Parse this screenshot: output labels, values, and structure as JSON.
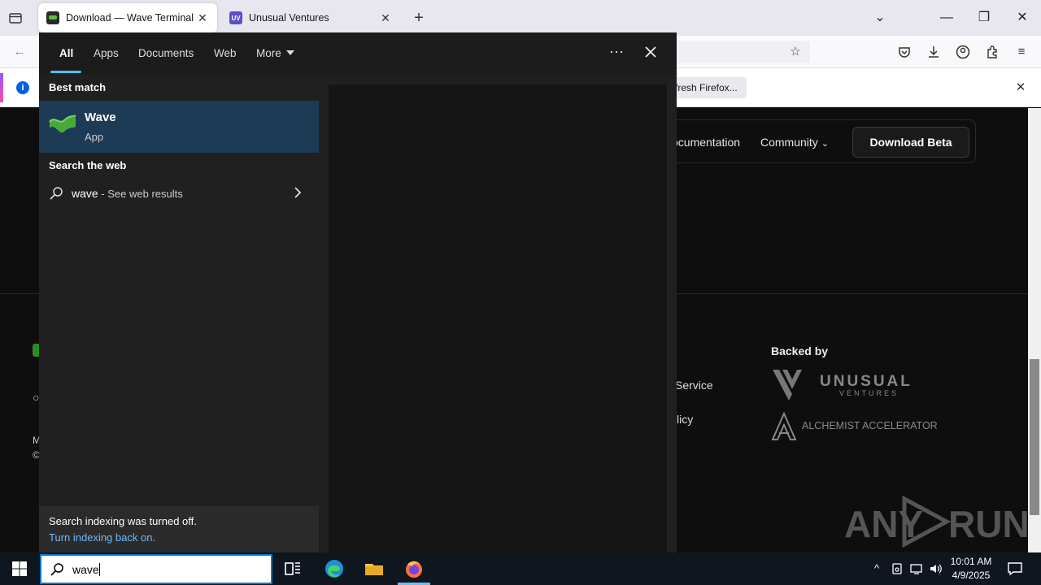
{
  "browser": {
    "tabs": [
      {
        "title": "Download — Wave Terminal",
        "active": true
      },
      {
        "title": "Unusual Ventures",
        "favicon_text": "UV",
        "active": false
      }
    ],
    "notification": {
      "info_glyph": "i",
      "action": "fresh Firefox..."
    }
  },
  "webpage": {
    "nav": {
      "documentation": "ocumentation",
      "community": "Community",
      "download_beta": "Download Beta"
    },
    "footer": {
      "backed_by": "Backed by",
      "terms_fragment": "Service",
      "privacy_fragment": "licy",
      "left_m": "M",
      "left_c": "©"
    },
    "sponsors": {
      "uv_top": "UNUSUAL",
      "uv_bottom": "VENTURES",
      "alchemist": "ALCHEMIST ACCELERATOR"
    },
    "watermark": {
      "left": "ANY",
      "right": "RUN"
    }
  },
  "search_panel": {
    "tabs": [
      "All",
      "Apps",
      "Documents",
      "Web",
      "More"
    ],
    "active_tab": "All",
    "best_match_heading": "Best match",
    "best_match": {
      "title": "Wave",
      "subtitle": "App"
    },
    "search_web_heading": "Search the web",
    "web_result": {
      "term": "wave",
      "hint": " - See web results"
    },
    "indexing": {
      "message": "Search indexing was turned off.",
      "link": "Turn indexing back on."
    }
  },
  "taskbar": {
    "search_query": "wave",
    "clock": {
      "time": "10:01 AM",
      "date": "4/9/2025"
    }
  },
  "colors": {
    "accent": "#4cc2ff",
    "selection": "#1d3b54",
    "link": "#6cb8ff",
    "taskbar": "#0f1620"
  }
}
